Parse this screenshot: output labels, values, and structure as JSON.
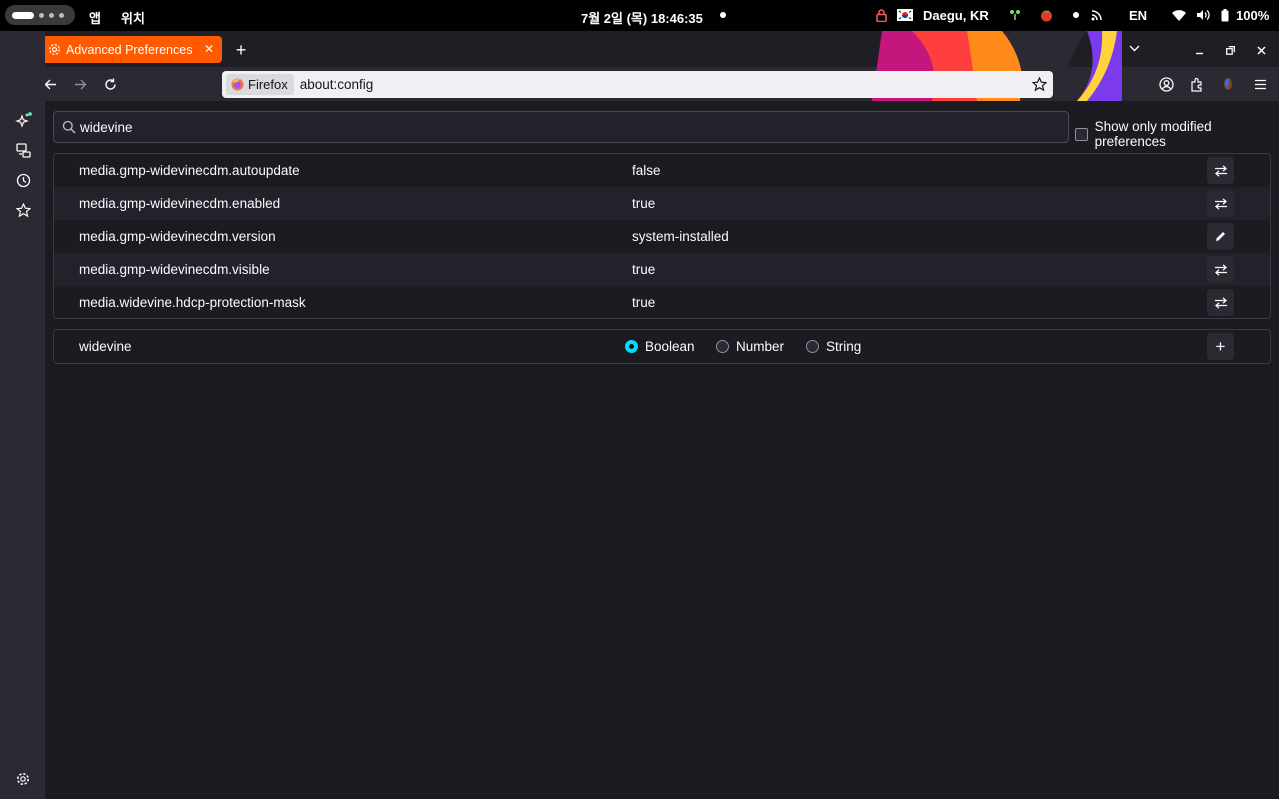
{
  "topbar": {
    "apps_label": "앱",
    "location_label": "위치",
    "clock": "7월 2일 (목)  18:46:35",
    "weather_location": "Daegu, KR",
    "input_lang": "EN",
    "battery": "100%"
  },
  "tab": {
    "title": "Advanced Preferences",
    "close": "✕"
  },
  "new_tab": "+",
  "urlbar": {
    "identity_label": "Firefox",
    "url": "about:config"
  },
  "search": {
    "value": "widevine"
  },
  "modified_only_label": "Show only modified preferences",
  "preferences": [
    {
      "name": "media.gmp-widevinecdm.autoupdate",
      "value": "false",
      "action": "toggle-icon"
    },
    {
      "name": "media.gmp-widevinecdm.enabled",
      "value": "true",
      "action": "toggle-icon"
    },
    {
      "name": "media.gmp-widevinecdm.version",
      "value": "system-installed",
      "action": "edit-icon"
    },
    {
      "name": "media.gmp-widevinecdm.visible",
      "value": "true",
      "action": "toggle-icon"
    },
    {
      "name": "media.widevine.hdcp-protection-mask",
      "value": "true",
      "action": "toggle-icon"
    }
  ],
  "new_pref": {
    "name": "widevine",
    "types": [
      "Boolean",
      "Number",
      "String"
    ],
    "selected": "Boolean",
    "add": "+"
  },
  "colors": {
    "tab_accent": "#ff5a00",
    "radio_accent": "#00ddff",
    "background": "#1c1b22"
  }
}
